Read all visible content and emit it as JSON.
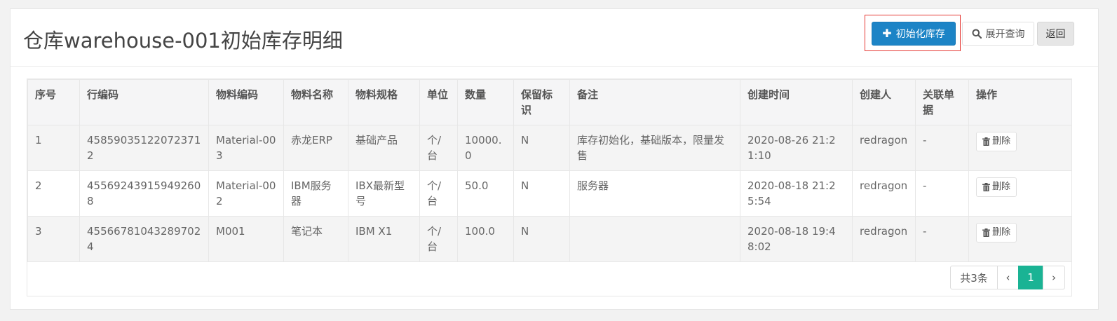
{
  "header": {
    "title": "仓库warehouse-001初始库存明细",
    "init_label": "初始化库存",
    "expand_label": "展开查询",
    "back_label": "返回"
  },
  "table": {
    "columns": [
      "序号",
      "行编码",
      "物料编码",
      "物料名称",
      "物料规格",
      "单位",
      "数量",
      "保留标识",
      "备注",
      "创建时间",
      "创建人",
      "关联单据",
      "操作"
    ],
    "rows": [
      [
        "1",
        "458590351220723712",
        "Material-003",
        "赤龙ERP",
        "基础产品",
        "个/台",
        "10000.0",
        "N",
        "库存初始化，基础版本，限量发售",
        "2020-08-26 21:21:10",
        "redragon",
        "-"
      ],
      [
        "2",
        "455692439159492608",
        "Material-002",
        "IBM服务器",
        "IBX最新型号",
        "个/台",
        "50.0",
        "N",
        "服务器",
        "2020-08-18 21:25:54",
        "redragon",
        "-"
      ],
      [
        "3",
        "455667810432897024",
        "M001",
        "笔记本",
        "IBM X1",
        "个/台",
        "100.0",
        "N",
        "",
        "2020-08-18 19:48:02",
        "redragon",
        "-"
      ]
    ],
    "delete_label": "删除"
  },
  "pagination": {
    "total_label": "共3条",
    "prev": "‹",
    "current_page": "1",
    "next": "›"
  },
  "colors": {
    "primary": "#1c84c6",
    "page_active": "#1ab394",
    "highlight": "#e53935"
  }
}
